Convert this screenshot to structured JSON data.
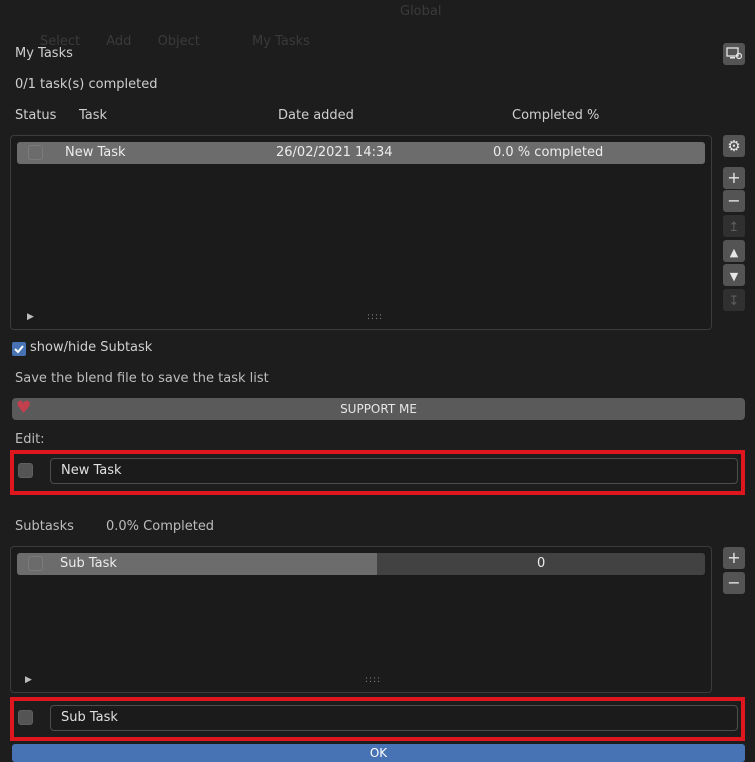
{
  "background_menu": {
    "items": [
      "Select",
      "Add",
      "Object",
      "My Tasks"
    ],
    "view_label": "Global"
  },
  "panel": {
    "title": "My Tasks",
    "completed_summary": "0/1 task(s) completed",
    "columns": [
      "Status",
      "Task",
      "Date added",
      "Completed %"
    ]
  },
  "tasks": [
    {
      "name": "New Task",
      "date": "26/02/2021 14:34",
      "completed": "0.0 % completed",
      "checked": false
    }
  ],
  "task_list_side_buttons": [
    "gear-icon",
    "add-icon",
    "remove-icon",
    "move-top-icon",
    "move-up-icon",
    "move-down-icon",
    "move-bottom-icon"
  ],
  "show_subtask": {
    "label": "show/hide Subtask",
    "checked": true
  },
  "save_hint": "Save the blend file to save the task list",
  "support": {
    "label": "SUPPORT ME",
    "heart_color": "#c2404e"
  },
  "edit": {
    "label": "Edit:",
    "task_name": "New Task"
  },
  "subtasks": {
    "label": "Subtasks",
    "completed": "0.0% Completed",
    "items": [
      {
        "name": "Sub Task",
        "value": "0",
        "checked": false
      }
    ],
    "edit_name": "Sub Task"
  },
  "ok_label": "OK",
  "colors": {
    "highlight_frame": "#e0161f",
    "ok_button": "#4772b3"
  }
}
